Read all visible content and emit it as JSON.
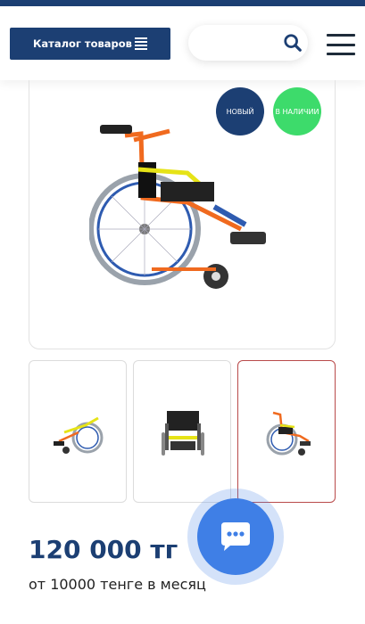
{
  "header": {
    "catalog_label": "Каталог товаров",
    "search": {
      "value": "",
      "placeholder": ""
    }
  },
  "product": {
    "badges": {
      "new": "НОВЫЙ",
      "in_stock": "В НАЛИЧИИ"
    },
    "price": "120 000 тг",
    "installment": "от 10000 тенге в месяц"
  },
  "colors": {
    "brand": "#1c3f73",
    "in_stock_badge": "#3ddb6b",
    "chat_button": "#3f7fe6",
    "selected_thumb_border": "#b94a4a"
  },
  "icons": {
    "catalog": "list-icon",
    "search": "search-icon",
    "menu": "hamburger-menu-icon",
    "chat": "chat-bubble-icon"
  },
  "gallery": {
    "thumbnail_count": 3,
    "selected_index": 3
  }
}
